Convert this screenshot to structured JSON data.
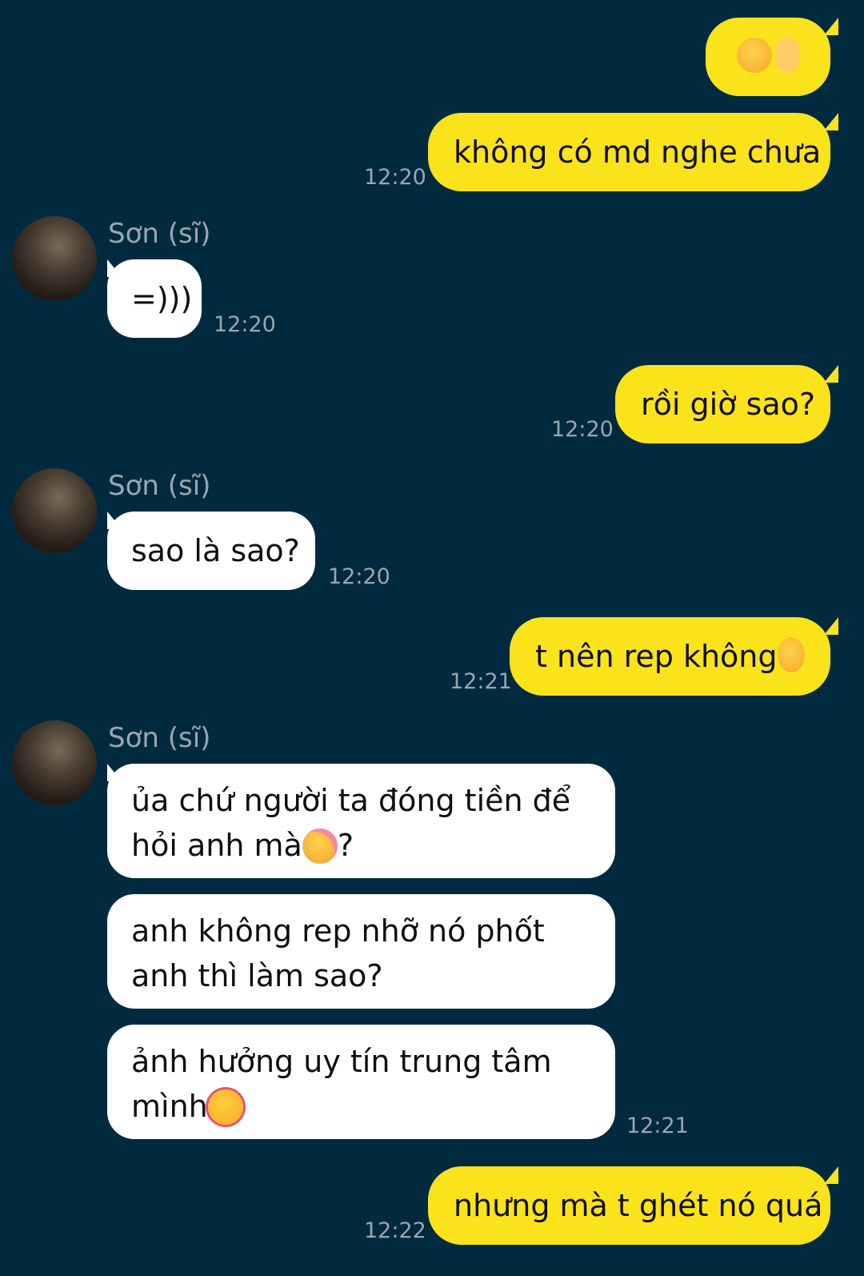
{
  "sender_name": "Sơn (sĩ)",
  "colors": {
    "background": "#022a3f",
    "outgoing": "#fbe31b",
    "incoming": "#ffffff",
    "timestamp": "#9aa6ae"
  },
  "messages": [
    {
      "dir": "out",
      "text": "",
      "emoji": [
        "grinning-sweat-emoji",
        "middle-finger-emoji"
      ]
    },
    {
      "dir": "out",
      "text": "không có md nghe chưa",
      "time": "12:20"
    },
    {
      "dir": "in",
      "text": "=)))",
      "time": "12:20"
    },
    {
      "dir": "out",
      "text": "rồi giờ sao?",
      "time": "12:20"
    },
    {
      "dir": "in",
      "text": "sao là sao?",
      "time": "12:20"
    },
    {
      "dir": "out",
      "text": "t nên rep không",
      "emoji": [
        "grinning-sweat-emoji"
      ],
      "time": "12:21"
    },
    {
      "dir": "in",
      "text_before": "ủa chứ người ta đóng tiền để hỏi anh mà",
      "emoji": [
        "smiling-blush-emoji"
      ],
      "text_after": "?"
    },
    {
      "dir": "in",
      "text": "anh không rep nhỡ nó phốt anh thì làm sao?"
    },
    {
      "dir": "in",
      "text": "ảnh hưởng uy tín trung tâm mình",
      "emoji": [
        "smiling-hearts-emoji"
      ],
      "time": "12:21"
    },
    {
      "dir": "out",
      "text": "nhưng mà t ghét nó quá",
      "time": "12:22"
    }
  ]
}
